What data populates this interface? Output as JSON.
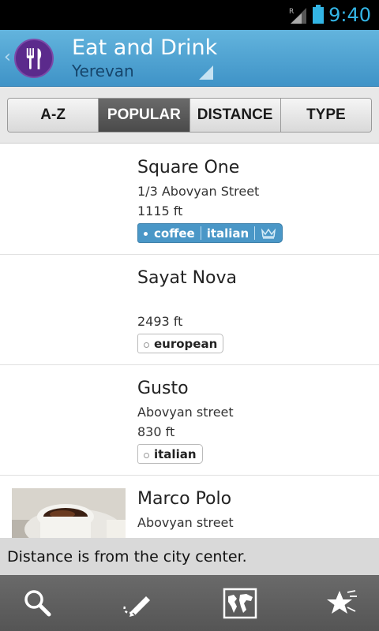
{
  "status_bar": {
    "time": "9:40",
    "roaming_indicator": "R",
    "icons": [
      "signal-icon",
      "battery-icon"
    ]
  },
  "header": {
    "title": "Eat and Drink",
    "subtitle": "Yerevan",
    "icon": "fork-knife-icon",
    "accent_color": "#5b2a8c"
  },
  "tabs": [
    {
      "label": "A-Z",
      "active": false
    },
    {
      "label": "POPULAR",
      "active": true
    },
    {
      "label": "DISTANCE",
      "active": false
    },
    {
      "label": "TYPE",
      "active": false
    }
  ],
  "places": [
    {
      "name": "Square One",
      "address": "1/3 Abovyan Street",
      "distance": "1115 ft",
      "tags": [
        "coffee",
        "italian"
      ],
      "featured": true
    },
    {
      "name": "Sayat Nova",
      "address": "",
      "distance": "2493 ft",
      "tags": [
        "european"
      ],
      "featured": false
    },
    {
      "name": "Gusto",
      "address": "Abovyan street",
      "distance": "830 ft",
      "tags": [
        "italian"
      ],
      "featured": false
    },
    {
      "name": "Marco Polo",
      "address": "Abovyan street",
      "distance": "",
      "tags": [],
      "featured": false
    }
  ],
  "toast": {
    "message": "Distance is from the city center."
  },
  "bottom_bar": {
    "buttons": [
      "search-icon",
      "pen-trail-icon",
      "world-map-icon",
      "favorites-star-icon"
    ]
  }
}
